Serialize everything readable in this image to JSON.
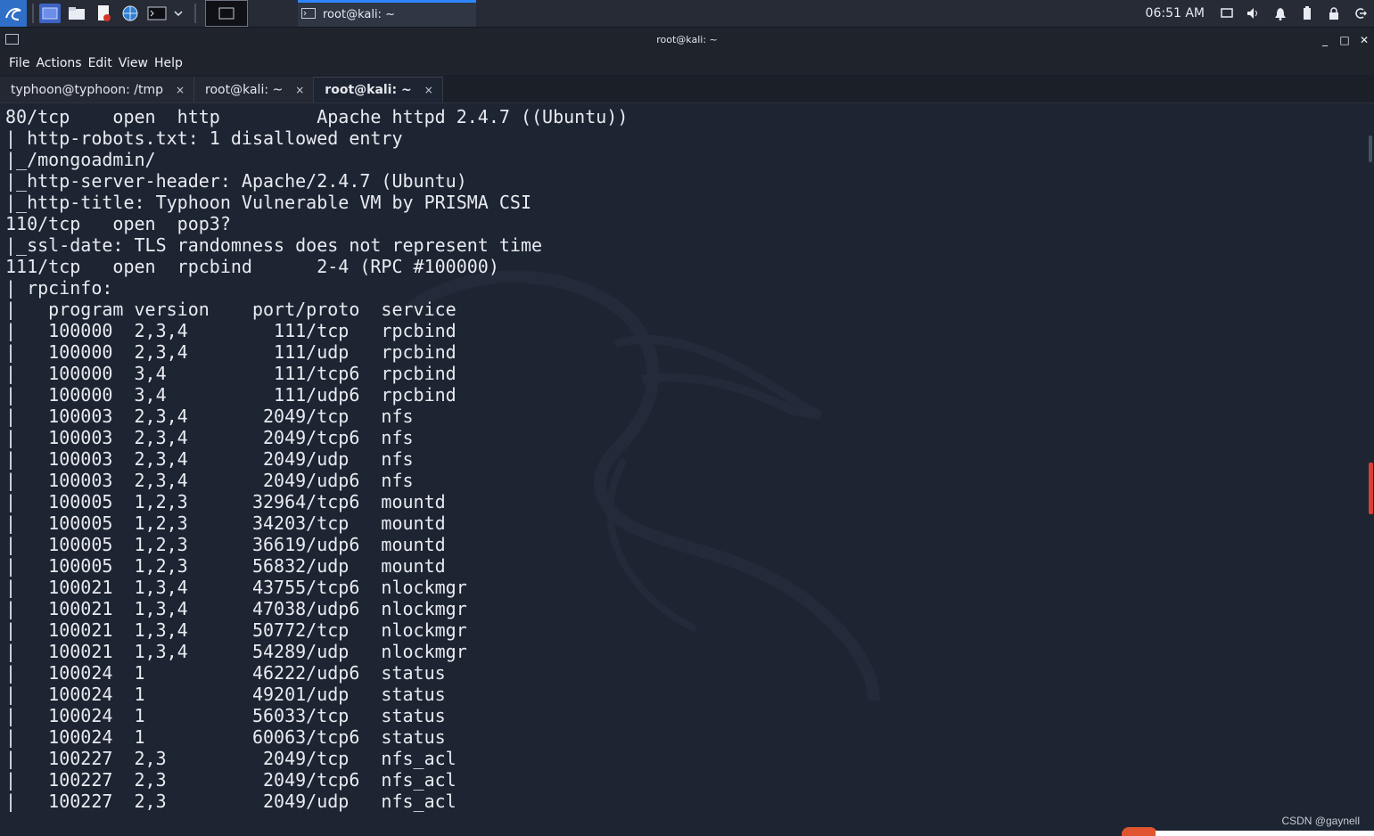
{
  "taskbar": {
    "window_task_label": "root@kali: ~",
    "clock": "06:51 AM"
  },
  "window": {
    "title": "root@kali: ~",
    "minimize": "_",
    "maximize": "□",
    "close": "✕"
  },
  "menu": [
    "File",
    "Actions",
    "Edit",
    "View",
    "Help"
  ],
  "tabs": [
    {
      "label": "typhoon@typhoon: /tmp",
      "close": "×"
    },
    {
      "label": "root@kali: ~",
      "close": "×"
    },
    {
      "label": "root@kali: ~",
      "close": "×",
      "active": true
    }
  ],
  "terminal_lines": [
    "80/tcp    open  http         Apache httpd 2.4.7 ((Ubuntu))",
    "| http-robots.txt: 1 disallowed entry",
    "|_/mongoadmin/",
    "|_http-server-header: Apache/2.4.7 (Ubuntu)",
    "|_http-title: Typhoon Vulnerable VM by PRISMA CSI",
    "110/tcp   open  pop3?",
    "|_ssl-date: TLS randomness does not represent time",
    "111/tcp   open  rpcbind      2-4 (RPC #100000)",
    "| rpcinfo:",
    "|   program version    port/proto  service",
    "|   100000  2,3,4        111/tcp   rpcbind",
    "|   100000  2,3,4        111/udp   rpcbind",
    "|   100000  3,4          111/tcp6  rpcbind",
    "|   100000  3,4          111/udp6  rpcbind",
    "|   100003  2,3,4       2049/tcp   nfs",
    "|   100003  2,3,4       2049/tcp6  nfs",
    "|   100003  2,3,4       2049/udp   nfs",
    "|   100003  2,3,4       2049/udp6  nfs",
    "|   100005  1,2,3      32964/tcp6  mountd",
    "|   100005  1,2,3      34203/tcp   mountd",
    "|   100005  1,2,3      36619/udp6  mountd",
    "|   100005  1,2,3      56832/udp   mountd",
    "|   100021  1,3,4      43755/tcp6  nlockmgr",
    "|   100021  1,3,4      47038/udp6  nlockmgr",
    "|   100021  1,3,4      50772/tcp   nlockmgr",
    "|   100021  1,3,4      54289/udp   nlockmgr",
    "|   100024  1          46222/udp6  status",
    "|   100024  1          49201/udp   status",
    "|   100024  1          56033/tcp   status",
    "|   100024  1          60063/tcp6  status",
    "|   100227  2,3         2049/tcp   nfs_acl",
    "|   100227  2,3         2049/tcp6  nfs_acl",
    "|   100227  2,3         2049/udp   nfs_acl"
  ],
  "watermark": "CSDN @gaynell",
  "colors": {
    "terminal_bg": "#1d2432",
    "panel_bg": "#262b36",
    "accent": "#2d86ff",
    "text": "#e8ebf0"
  },
  "icons": {
    "launcher": "kali-dragon-icon",
    "tray": [
      "display-icon",
      "volume-icon",
      "bell-icon",
      "battery-icon",
      "lock-icon",
      "logout-icon"
    ]
  }
}
